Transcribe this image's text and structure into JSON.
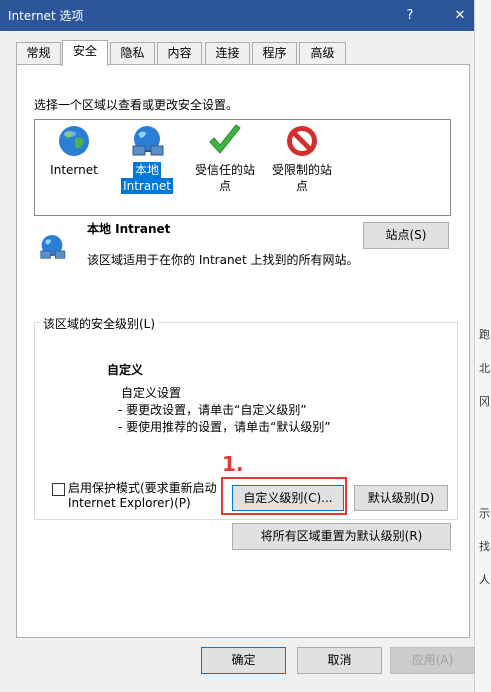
{
  "window": {
    "title": "Internet 选项",
    "help_glyph": "?",
    "close_glyph": "✕"
  },
  "tabs": [
    "常规",
    "安全",
    "隐私",
    "内容",
    "连接",
    "程序",
    "高级"
  ],
  "security": {
    "instruction": "选择一个区域以查看或更改安全设置。",
    "zones": [
      {
        "label_line1": "Internet",
        "label_line2": "",
        "icon": "globe-icon"
      },
      {
        "label_line1": "本地",
        "label_line2": "Intranet",
        "icon": "intranet-globe-icon"
      },
      {
        "label_line1": "受信任的站",
        "label_line2": "点",
        "icon": "checkmark-icon"
      },
      {
        "label_line1": "受限制的站",
        "label_line2": "点",
        "icon": "restricted-icon"
      }
    ],
    "zone_detail": {
      "title": "本地 Intranet",
      "description": "该区域适用于在你的 Intranet 上找到的所有网站。",
      "sites_button": "站点(S)"
    },
    "level_group": {
      "label": "该区域的安全级别(L)",
      "level_name": "自定义",
      "line1": "自定义设置",
      "line2": "- 要更改设置，请单击“自定义级别”",
      "line3": "- 要使用推荐的设置，请单击“默认级别”"
    },
    "protected_mode": {
      "line1": "启用保护模式(要求重新启动",
      "line2": "Internet Explorer)(P)",
      "checked": false
    },
    "custom_level_button": "自定义级别(C)...",
    "default_level_button": "默认级别(D)",
    "reset_all_button": "将所有区域重置为默认级别(R)"
  },
  "annotation": {
    "number": "1."
  },
  "footer": {
    "ok": "确定",
    "cancel": "取消",
    "apply": "应用(A)"
  },
  "background_strip": [
    "跑",
    "北",
    "冈",
    "示",
    "找",
    "人"
  ],
  "colors": {
    "titlebar": "#2b579a",
    "selected": "#0078d7",
    "annotation": "#e53935"
  }
}
